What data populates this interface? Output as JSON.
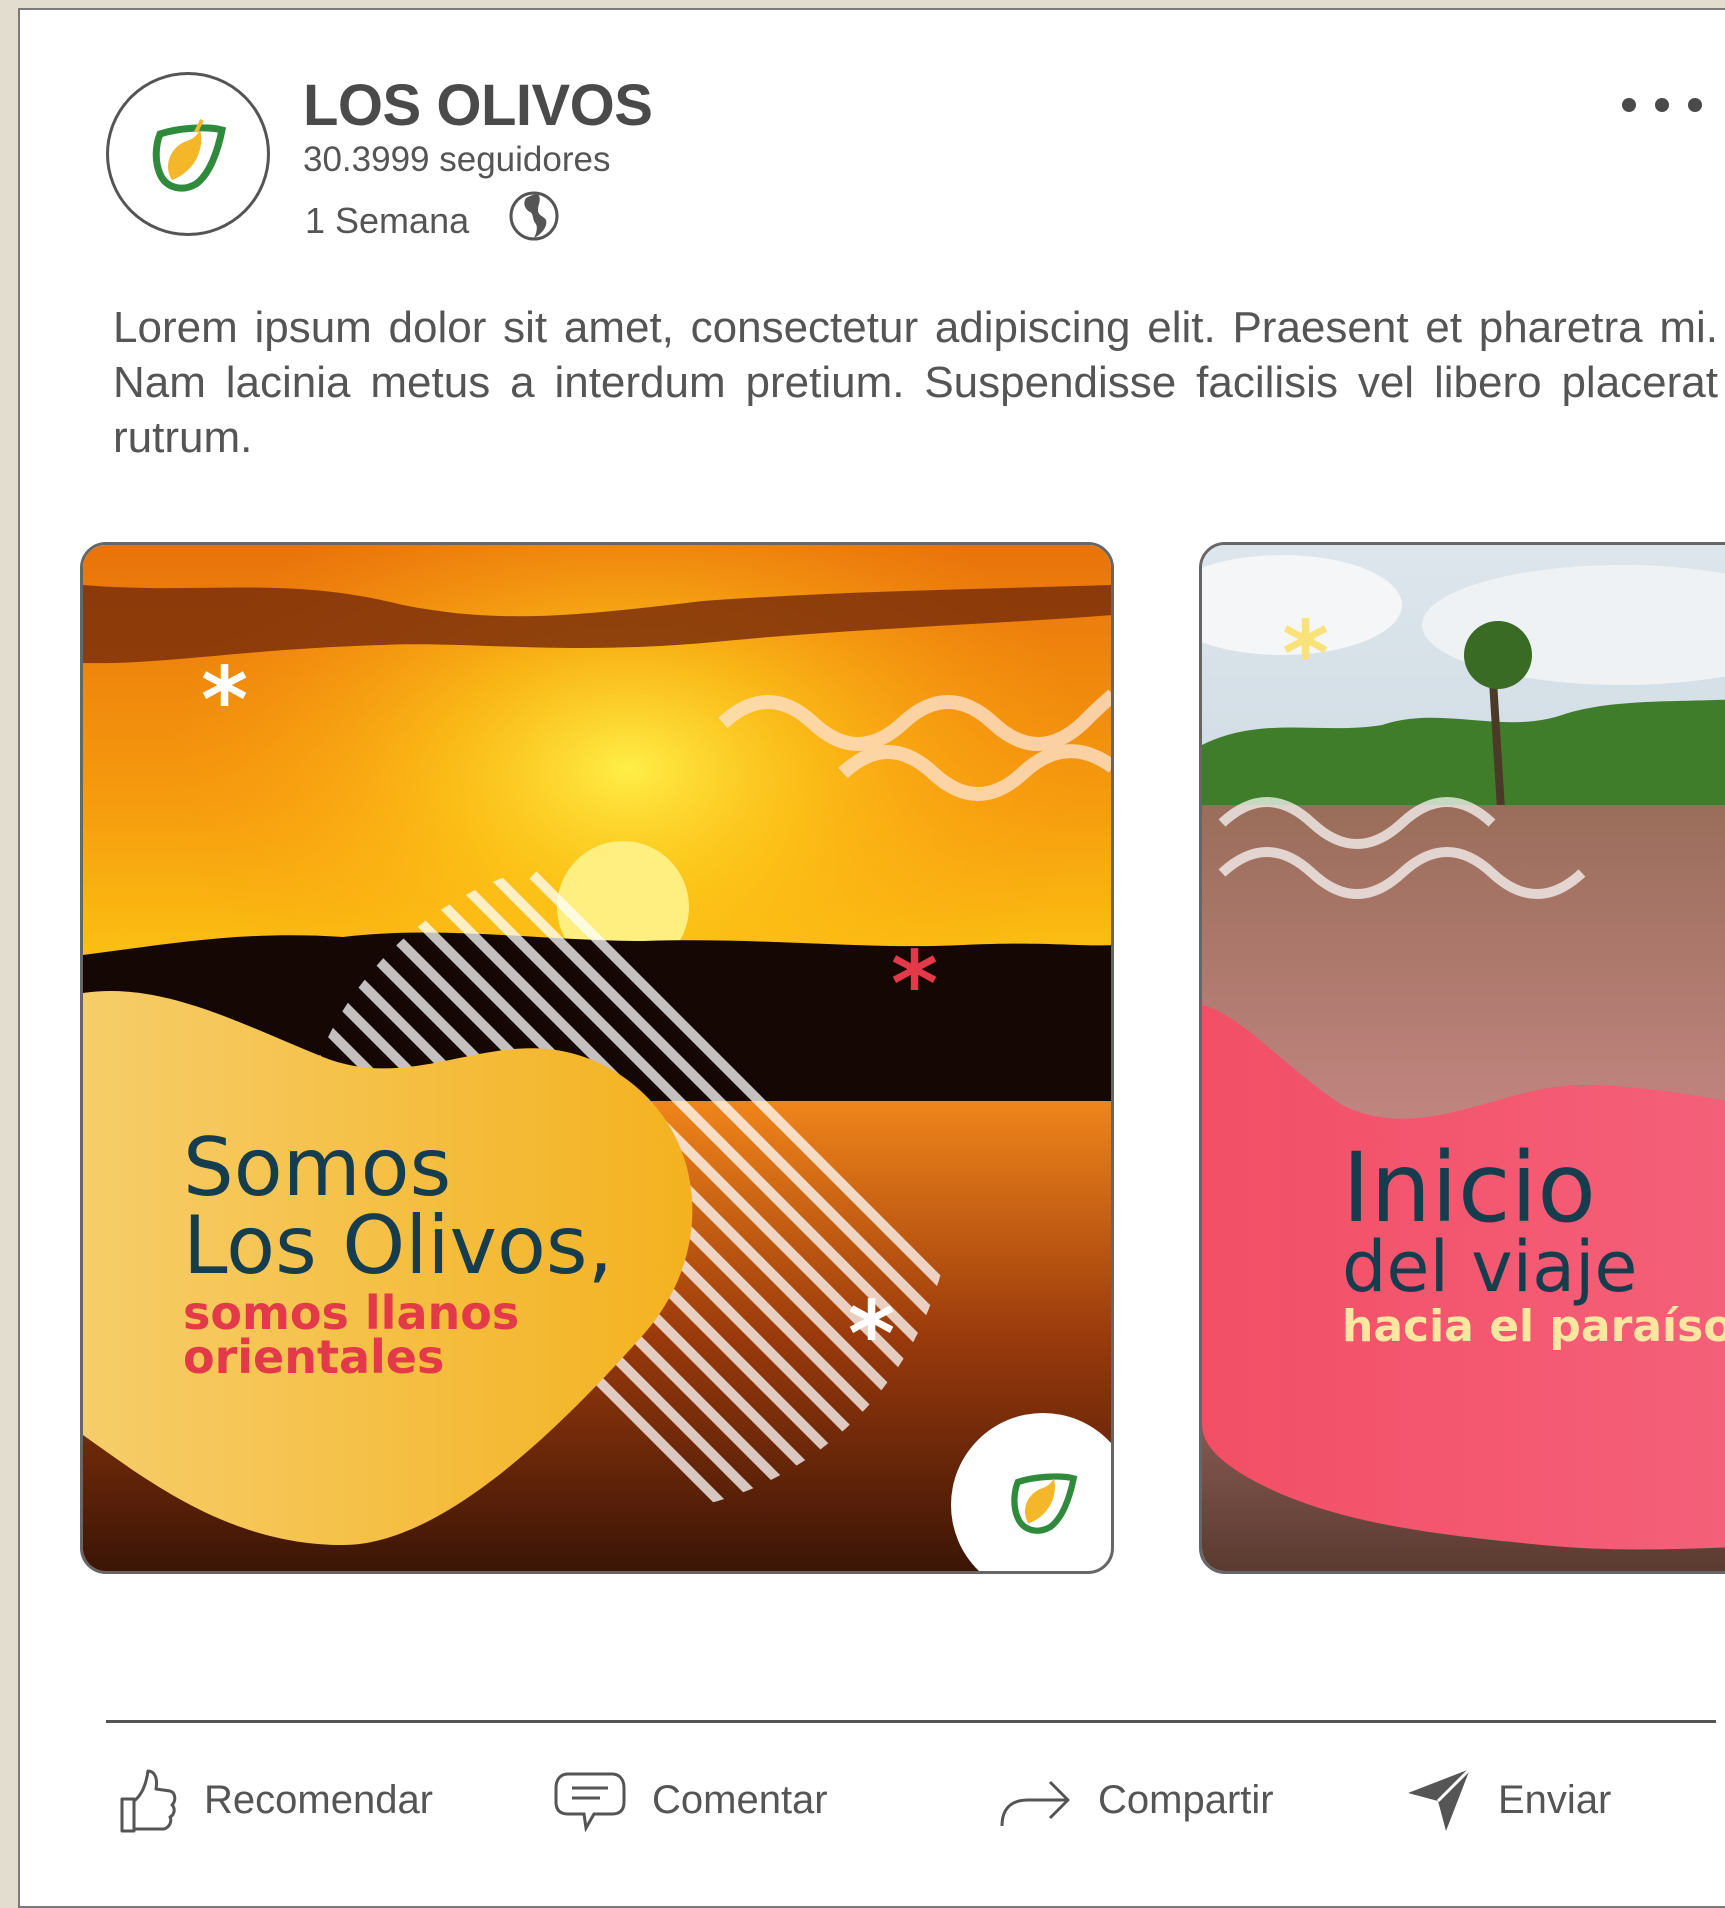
{
  "post": {
    "author": "LOS OLIVOS",
    "followers": "30.3999 seguidores",
    "time": "1 Semana",
    "body": "Lorem ipsum dolor sit amet, consectetur adipiscing elit. Praesent et pharetra mi. Nam lacinia metus a interdum pretium. Suspendisse facilisis vel libero placerat rutrum.",
    "more_icon": "more-horizontal-icon",
    "visibility_icon": "globe-icon"
  },
  "carousel": [
    {
      "line1": "Somos",
      "line2": "Los Olivos,",
      "line3": "somos llanos",
      "line4": "orientales"
    },
    {
      "line1": "Inicio",
      "line2": "del viaje",
      "line3": "hacia el paraíso"
    }
  ],
  "actions": [
    {
      "label": "Recomendar",
      "icon": "thumbs-up-icon"
    },
    {
      "label": "Comentar",
      "icon": "comment-icon"
    },
    {
      "label": "Compartir",
      "icon": "share-arrow-icon"
    },
    {
      "label": "Enviar",
      "icon": "send-icon"
    }
  ],
  "colors": {
    "brand_green": "#2f8a3c",
    "brand_yellow": "#f4b72a",
    "coral": "#f0566a",
    "navy_text": "#163d4e"
  }
}
